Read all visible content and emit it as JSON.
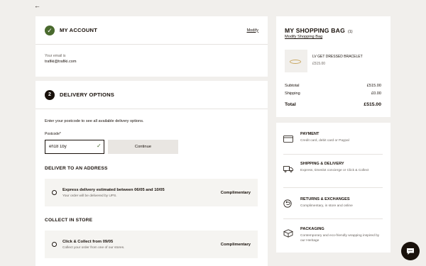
{
  "account": {
    "title": "MY ACCOUNT",
    "modify_label": "Modify",
    "email_label": "Your email is",
    "email": "trafiki@trafiki.com"
  },
  "delivery": {
    "step": "2",
    "title": "DELIVERY OPTIONS",
    "intro": "Enter your postcode to see all available delivery options.",
    "postcode_label": "Postcode*",
    "postcode_value": "eh18 1by",
    "continue_label": "Continue",
    "address_title": "DELIVER TO AN ADDRESS",
    "address_option": {
      "main": "Express delivery estimated between 06/05 and 10/05",
      "sub": "Your order will be delivered by UPS.",
      "price": "Complimentary"
    },
    "store_title": "COLLECT IN STORE",
    "store_option": {
      "main": "Click & Collect from 09/05",
      "sub": "Collect your order from one of our stores.",
      "price": "Complimentary"
    }
  },
  "bag": {
    "title": "MY SHOPPING BAG",
    "count": "(1)",
    "modify_label": "Modify Shopping Bag",
    "product": {
      "name": "LV GET DRESSED BRACELET",
      "price": "£515.00"
    },
    "subtotal_label": "Subtotal",
    "subtotal_value": "£515.00",
    "shipping_label": "Shipping",
    "shipping_value": "£0.00",
    "total_label": "Total",
    "total_value": "£515.00"
  },
  "info": [
    {
      "icon": "card-icon",
      "title": "PAYMENT",
      "desc": "Credit card, debit card or Paypal"
    },
    {
      "icon": "truck-icon",
      "title": "SHIPPING & DELIVERY",
      "desc": "Express, timeslot concierge or Click & Collect"
    },
    {
      "icon": "return-icon",
      "title": "RETURNS & EXCHANGES",
      "desc": "Complimentary, in store and online"
    },
    {
      "icon": "package-icon",
      "title": "PACKAGING",
      "desc": "Contemporary and eco-friendly wrapping inspired by our Heritage"
    }
  ],
  "icons": {
    "back": "back-arrow-icon",
    "chat": "chat-icon"
  },
  "colors": {
    "accent_green": "#4a6a2e",
    "text": "#19110b",
    "background": "#f1efec"
  }
}
